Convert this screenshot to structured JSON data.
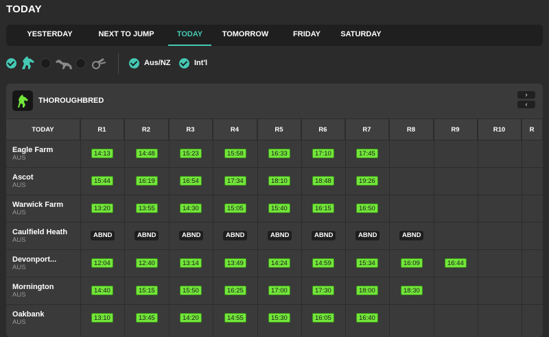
{
  "page": {
    "title": "TODAY"
  },
  "tabs": [
    {
      "label": "YESTERDAY",
      "active": false
    },
    {
      "label": "NEXT TO JUMP",
      "active": false
    },
    {
      "label": "TODAY",
      "active": true
    },
    {
      "label": "TOMORROW",
      "active": false
    },
    {
      "label": "FRIDAY",
      "active": false
    },
    {
      "label": "SATURDAY",
      "active": false
    }
  ],
  "filters": {
    "codes": [
      {
        "icon": "horse-icon",
        "checked": true
      },
      {
        "icon": "greyhound-icon",
        "checked": false
      },
      {
        "icon": "harness-icon",
        "checked": false
      }
    ],
    "regions": [
      {
        "label": "Aus/NZ",
        "checked": true
      },
      {
        "label": "Int'l",
        "checked": true
      }
    ]
  },
  "colors": {
    "accent": "#45c9b5",
    "time_chip": "#72e53a",
    "abandoned_chip": "#1e1e1e"
  },
  "panel": {
    "title": "THOROUGHBRED",
    "icon": "thoroughbred-horse-icon",
    "next_label": "›",
    "prev_label": "‹"
  },
  "table": {
    "first_header": "TODAY",
    "race_headers": [
      "R1",
      "R2",
      "R3",
      "R4",
      "R5",
      "R6",
      "R7",
      "R8",
      "R9",
      "R10",
      "R"
    ],
    "rows": [
      {
        "venue": "Eagle Farm",
        "country": "AUS",
        "races": [
          "14:13",
          "14:48",
          "15:23",
          "15:58",
          "16:33",
          "17:10",
          "17:45"
        ]
      },
      {
        "venue": "Ascot",
        "country": "AUS",
        "races": [
          "15:44",
          "16:19",
          "16:54",
          "17:34",
          "18:10",
          "18:48",
          "19:26"
        ]
      },
      {
        "venue": "Warwick Farm",
        "country": "AUS",
        "races": [
          "13:20",
          "13:55",
          "14:30",
          "15:05",
          "15:40",
          "16:15",
          "16:50"
        ]
      },
      {
        "venue": "Caulfield Heath",
        "country": "AUS",
        "races": [
          "ABND",
          "ABND",
          "ABND",
          "ABND",
          "ABND",
          "ABND",
          "ABND",
          "ABND"
        ]
      },
      {
        "venue": "Devonport...",
        "country": "AUS",
        "races": [
          "12:04",
          "12:40",
          "13:14",
          "13:49",
          "14:24",
          "14:59",
          "15:34",
          "16:09",
          "16:44"
        ]
      },
      {
        "venue": "Mornington",
        "country": "AUS",
        "races": [
          "14:40",
          "15:15",
          "15:50",
          "16:25",
          "17:00",
          "17:30",
          "18:00",
          "18:30"
        ]
      },
      {
        "venue": "Oakbank",
        "country": "AUS",
        "races": [
          "13:10",
          "13:45",
          "14:20",
          "14:55",
          "15:30",
          "16:05",
          "16:40"
        ]
      }
    ]
  }
}
